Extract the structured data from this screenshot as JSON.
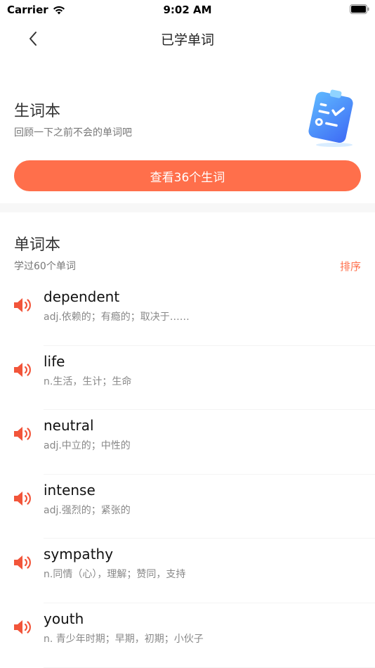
{
  "status_bar": {
    "carrier": "Carrier",
    "time": "9:02 AM"
  },
  "nav": {
    "title": "已学单词",
    "back_icon": "chevron-left-icon"
  },
  "vocab_book": {
    "title": "生词本",
    "subtitle": "回顾一下之前不会的单词吧",
    "button_label": "查看36个生词",
    "illustration_icon": "clipboard-checklist-icon"
  },
  "wordbook": {
    "title": "单词本",
    "learned_count": "学过60个单词",
    "sort_label": "排序"
  },
  "words": [
    {
      "word": "dependent",
      "meaning": "adj.依赖的；有瘾的；取决于……"
    },
    {
      "word": "life",
      "meaning": "n.生活，生计；生命"
    },
    {
      "word": "neutral",
      "meaning": "adj.中立的；中性的"
    },
    {
      "word": "intense",
      "meaning": "adj.强烈的；紧张的"
    },
    {
      "word": "sympathy",
      "meaning": "n.同情（心），理解；赞同，支持"
    },
    {
      "word": "youth",
      "meaning": "n. 青少年时期；早期，初期；小伙子"
    }
  ],
  "colors": {
    "accent": "#FF6F4B",
    "speaker": "#F2553A",
    "divider": "#F7F7F7"
  }
}
